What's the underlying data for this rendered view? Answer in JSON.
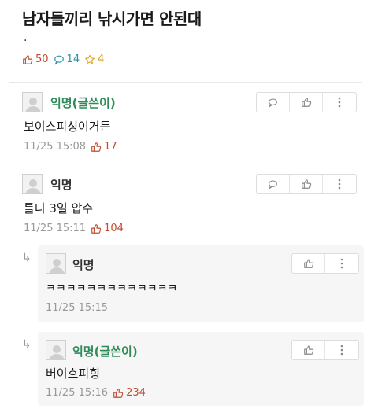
{
  "post": {
    "title": "남자들끼리 낚시가면 안된대",
    "body": ".",
    "likes": "50",
    "comments": "14",
    "scraps": "4"
  },
  "comments": [
    {
      "author": "익명(글쓴이)",
      "text": "보이스피싱이거든",
      "time": "11/25 15:08",
      "likes": "17"
    },
    {
      "author": "익명",
      "text": "틀니 3일 압수",
      "time": "11/25 15:11",
      "likes": "104"
    },
    {
      "author": "익명",
      "text": "ㅋㅋㅋㅋㅋㅋㅋㅋㅋㅋㅋㅋㅋ",
      "time": "11/25 15:15"
    },
    {
      "author": "익명(글쓴이)",
      "text": "버이흐피힝",
      "time": "11/25 15:16",
      "likes": "234"
    }
  ],
  "icons": {
    "like": "thumbs-up-icon",
    "comment": "speech-bubble-icon",
    "scrap": "star-icon",
    "more": "more-vertical-icon",
    "reply": "reply-arrow-icon",
    "avatar": "default-avatar"
  },
  "colors": {
    "like": "#c24a2f",
    "comment": "#2a8fa6",
    "scrap": "#d8a11c",
    "op_author": "#2e8b57"
  }
}
